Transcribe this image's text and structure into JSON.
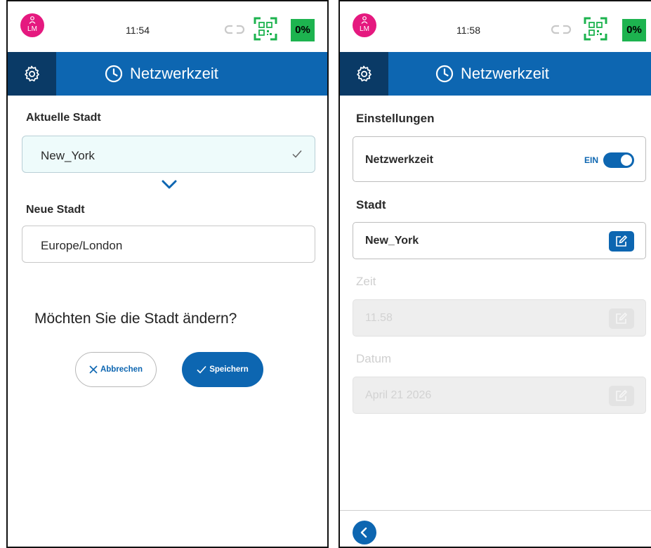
{
  "left": {
    "status": {
      "avatar_initials": "LM",
      "time": "11:54",
      "battery": "0%"
    },
    "header": {
      "title": "Netzwerkzeit"
    },
    "current_city": {
      "label": "Aktuelle Stadt",
      "value": "New_York"
    },
    "new_city": {
      "label": "Neue Stadt",
      "value": "Europe/London"
    },
    "question": "Möchten Sie die Stadt ändern?",
    "buttons": {
      "cancel": "Abbrechen",
      "save": "Speichern"
    }
  },
  "right": {
    "status": {
      "avatar_initials": "LM",
      "time": "11:58",
      "battery": "0%"
    },
    "header": {
      "title": "Netzwerkzeit"
    },
    "settings": {
      "label": "Einstellungen",
      "network_time_label": "Netzwerkzeit",
      "toggle_state": "EIN"
    },
    "city": {
      "label": "Stadt",
      "value": "New_York"
    },
    "time": {
      "label": "Zeit",
      "value": "11.58"
    },
    "date": {
      "label": "Datum",
      "value": "April 21 2026"
    }
  },
  "colors": {
    "primary": "#0d66b1",
    "header_dark": "#0a3a66",
    "avatar": "#e5197f",
    "battery": "#1db34f",
    "qr": "#1db34f"
  },
  "icons": [
    "user-icon",
    "link-icon",
    "qr-code-icon",
    "gear-icon",
    "clock-icon",
    "check-icon",
    "chevron-down-icon",
    "close-icon",
    "edit-icon",
    "chevron-left-icon"
  ]
}
